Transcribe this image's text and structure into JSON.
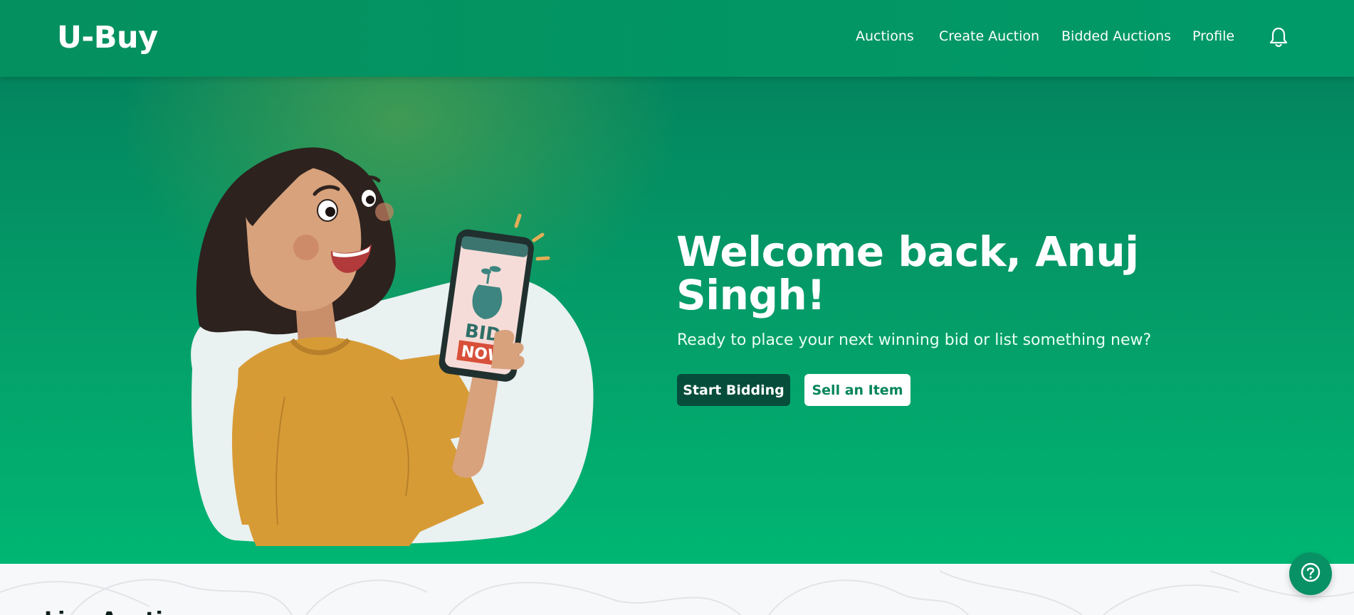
{
  "nav": {
    "logo": "U-Buy",
    "links": [
      "Auctions",
      "Create Auction",
      "Bidded Auctions",
      "Profile"
    ],
    "bell_icon": "bell-icon"
  },
  "hero": {
    "title": "Welcome back, Anuj Singh!",
    "subtitle": "Ready to place your next winning bid or list something new?",
    "primary_button": "Start Bidding",
    "secondary_button": "Sell an Item",
    "phone_text_top": "BID",
    "phone_text_bottom": "NOW"
  },
  "lower": {
    "title_partial": "Live Auctions"
  },
  "help": {
    "icon": "help-icon"
  },
  "colors": {
    "brand_green": "#05905f",
    "dark_button": "#064e3b",
    "accent_text": "#05855a"
  }
}
